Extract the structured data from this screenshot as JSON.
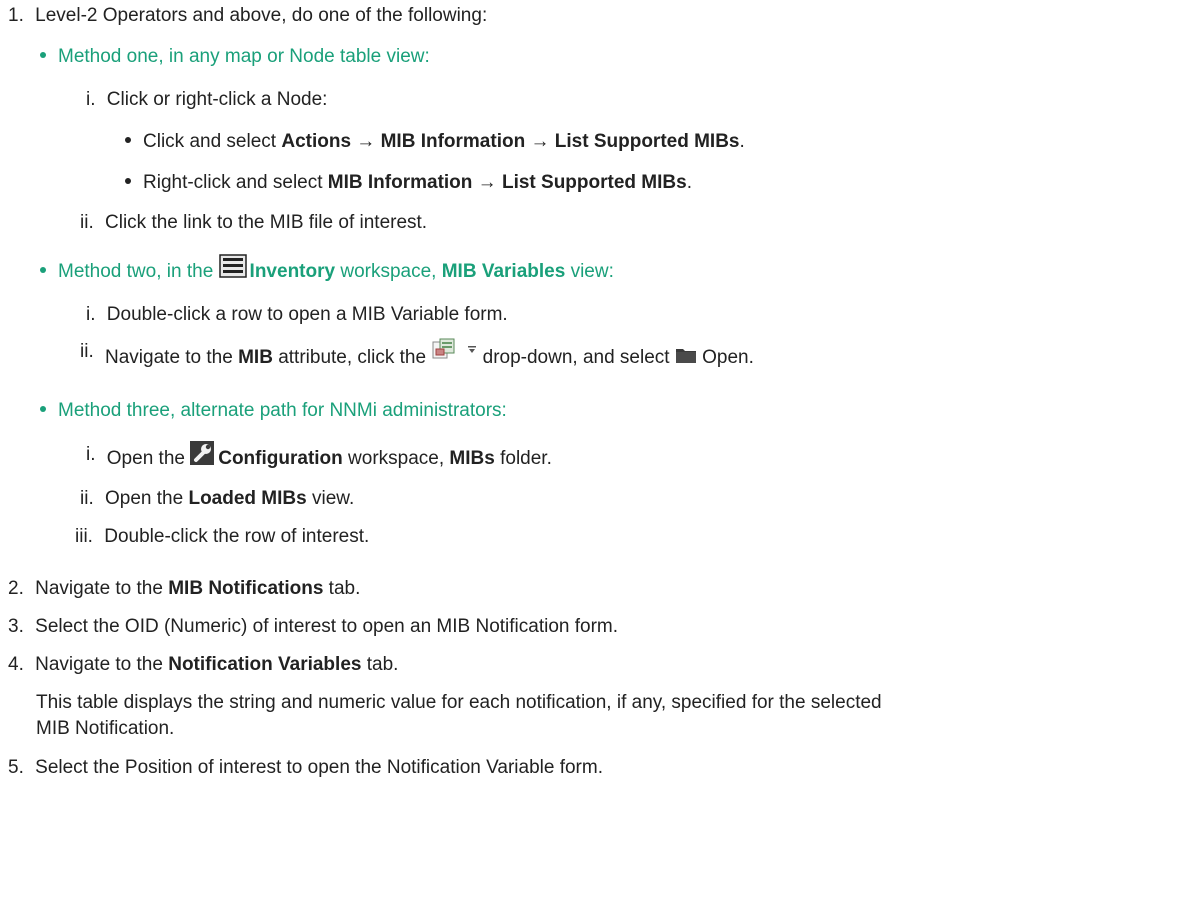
{
  "colors": {
    "accent": "#1aa07a",
    "text": "#222222"
  },
  "step1": {
    "num": "1.",
    "text": "Level-2 Operators and above, do one of the following:",
    "method1": {
      "title": "Method one, in any map or Node table view:",
      "i_num": "i.",
      "i_text": "Click or right-click a Node:",
      "sub_a_pre": "Click and select ",
      "sub_a_b1": "Actions",
      "sub_a_arrow1": " → ",
      "sub_a_b2": "MIB Information",
      "sub_a_arrow2": " → ",
      "sub_a_b3": "List Supported MIBs",
      "sub_a_end": ".",
      "sub_b_pre": "Right-click and select ",
      "sub_b_b1": "MIB Information",
      "sub_b_arrow": " → ",
      "sub_b_b2": "List Supported MIBs",
      "sub_b_end": ".",
      "ii_num": "ii.",
      "ii_text": "Click the link to the MIB file of interest."
    },
    "method2": {
      "pre": "Method two, in the ",
      "b1": "Inventory",
      "mid": " workspace, ",
      "b2": "MIB Variables",
      "end": " view:",
      "i_num": "i.",
      "i_text": "Double-click a row to open a MIB Variable form.",
      "ii_num": "ii.",
      "ii_pre": "Navigate to the ",
      "ii_b": "MIB",
      "ii_mid": " attribute, click the ",
      "ii_mid2": " drop-down, and select ",
      "ii_end": " Open."
    },
    "method3": {
      "title": "Method three, alternate path for NNMi administrators:",
      "i_num": "i.",
      "i_pre": "Open the ",
      "i_b1": "Configuration",
      "i_mid": " workspace, ",
      "i_b2": "MIBs",
      "i_end": " folder.",
      "ii_num": "ii.",
      "ii_pre": "Open the ",
      "ii_b": "Loaded MIBs",
      "ii_end": " view.",
      "iii_num": "iii.",
      "iii_text": "Double-click the row of interest."
    }
  },
  "step2": {
    "num": "2.",
    "pre": "Navigate to the ",
    "b": "MIB Notifications",
    "end": " tab."
  },
  "step3": {
    "num": "3.",
    "text": "Select the OID (Numeric) of interest to open an MIB Notification form."
  },
  "step4": {
    "num": "4.",
    "pre": "Navigate to the ",
    "b": "Notification Variables",
    "end": " tab.",
    "note_line1": "This table displays the string and numeric value for each notification, if any, specified for the selected",
    "note_line2": "MIB Notification."
  },
  "step5": {
    "num": "5.",
    "text": "Select the Position of interest to open the Notification Variable form."
  },
  "icons": {
    "inventory": "inventory-icon",
    "lookup": "lookup-icon",
    "dropdown": "dropdown-arrow-icon",
    "folder": "folder-icon",
    "configuration": "wrench-icon"
  }
}
